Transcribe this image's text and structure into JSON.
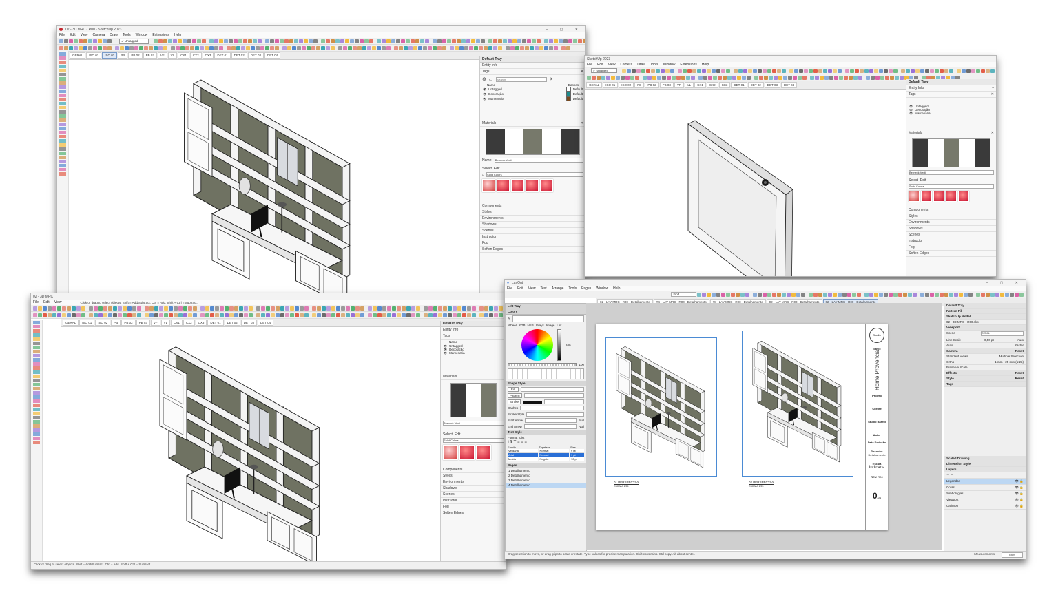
{
  "win1": {
    "title": "02 - 3D MRC - R00 - SketchUp 2023",
    "menu": [
      "File",
      "Edit",
      "View",
      "Camera",
      "Draw",
      "Tools",
      "Window",
      "Extensions",
      "Help"
    ],
    "tag_select": "Untagged",
    "tabs": [
      "GERAL",
      "ISO 01",
      "ISO 02",
      "PB",
      "PB 02",
      "PB 03",
      "VF",
      "VL",
      "CX1",
      "CX2",
      "CX3",
      "DET 01",
      "DET 02",
      "DET 03",
      "DET 04"
    ],
    "active_tab": 2,
    "tray": {
      "title": "Default Tray",
      "entity_info": "Entity Info",
      "tags": "Tags",
      "search_placeholder": "Search",
      "col_name": "Name",
      "col_dashes": "Dashes",
      "tag_rows": [
        {
          "name": "Untagged",
          "dash": "Default",
          "color": "#ffffff"
        },
        {
          "name": "Decoração",
          "dash": "Default",
          "color": "#1e8c8c"
        },
        {
          "name": "Marcenaria",
          "dash": "Default",
          "color": "#7a4a1e"
        }
      ],
      "materials": "Materials",
      "name_label": "Name:",
      "material_name": "Berneck Verti",
      "select": "Select",
      "edit": "Edit",
      "library": "Solid Colors",
      "sections": [
        "Components",
        "Styles",
        "Environments",
        "Shadows",
        "Scenes",
        "Instructor",
        "Fog",
        "Soften Edges"
      ]
    }
  },
  "win2": {
    "title": "SketchUp 2023",
    "tabs": [
      "GERAL",
      "ISO 01",
      "ISO 02",
      "PB",
      "PB 02",
      "PB 03",
      "VF",
      "VL",
      "CX1",
      "CX2",
      "CX3",
      "DET 01",
      "DET 02",
      "DET 03",
      "DET 04"
    ],
    "tag_select": "Untagged",
    "tray_title": "Default Tray",
    "entity_info": "Entity Info",
    "tags": "Tags",
    "tag_rows": [
      "Untagged",
      "Decoração",
      "Marcenaria"
    ],
    "materials": "Materials",
    "material_name": "Berneck Verti",
    "select": "Select",
    "edit": "Edit",
    "library": "Solid Colors",
    "sections": [
      "Components",
      "Styles",
      "Environments",
      "Shadows",
      "Scenes",
      "Instructor",
      "Fog",
      "Soften Edges"
    ]
  },
  "win3": {
    "title": "02 - 3D MRC",
    "menu": [
      "File",
      "Edit",
      "View"
    ],
    "hint": "Click or drag to select objects. Shift = Add/Subtract. Ctrl = Add. Shift + Ctrl = Subtract.",
    "tabs": [
      "GERAL",
      "ISO 01",
      "ISO 02",
      "PB",
      "PB 02",
      "PB 03",
      "VF",
      "VL",
      "CX1",
      "CX2",
      "CX3",
      "DET 01",
      "DET 02",
      "DET 03",
      "DET 04"
    ],
    "status": "Click or drag to select objects. Shift = Add/Subtract. Ctrl = Add. Shift + Ctrl = Subtract.",
    "tray_title": "Default Tray",
    "entity_info": "Entity Info",
    "tags": "Tags",
    "tag_rows": [
      "Untagged",
      "Decoração",
      "Marcenaria"
    ],
    "col_name": "Name",
    "materials": "Materials",
    "material_name": "Berneck Verti",
    "select": "Select",
    "edit": "Edit",
    "library": "Solid Colors",
    "sections": [
      "Components",
      "Styles",
      "Environments",
      "Shadows",
      "Scenes",
      "Instructor",
      "Fog",
      "Soften Edges"
    ]
  },
  "layout": {
    "title": "LayOut",
    "menu": [
      "File",
      "Edit",
      "View",
      "Text",
      "Arrange",
      "Tools",
      "Pages",
      "Window",
      "Help"
    ],
    "find": "Find...",
    "doc_tabs": [
      "02 - LAY MRC - R00 - Detalhamento",
      "#4 - LAY MRC - R00 - Detalhamento",
      "#8 - LAY MRC - R00 - Detalhamento",
      "02 - LAY MRC - R00 - Detalhamento",
      "02 - LAY MRC - R00 - Detalhamento"
    ],
    "left_tray": "Left Tray",
    "colors": "Colors",
    "color_tabs": [
      "Wheel",
      "RGB",
      "HSB",
      "Grays",
      "Image",
      "List"
    ],
    "color_opacity_a": "100",
    "color_opacity_b": "100",
    "shape_style": "Shape Style",
    "fill": "Fill",
    "pattern": "Pattern",
    "stroke": "Stroke",
    "dashes": "Dashes",
    "stroke_style": "Stroke Style",
    "start_arrow": "Start Arrow",
    "end_arrow": "End Arrow",
    "arrow_val": "Null",
    "text_style": "Text Style",
    "format": "Format",
    "list": "List",
    "family": "Family",
    "typeface": "Typeface",
    "size": "Size",
    "family_vals": [
      "Verdana",
      "Arial",
      "Mukta"
    ],
    "typeface_vals": [
      "Normal",
      "Normal",
      "Negrito"
    ],
    "size_vals": [
      "9 pt",
      "9 pt",
      "10 pt"
    ],
    "pages": "Pages",
    "page_list": [
      "1  Detalhamento",
      "2  Detalhamento",
      "3  Detalhamento",
      "4  Detalhamento"
    ],
    "right_tray": "Default Tray",
    "pattern_fill": "Pattern Fill",
    "sketchup_model": "SketchUp Model",
    "model_file": "02 - 3D MRC - R00.skp",
    "viewport": "Viewport",
    "scene": "Scene",
    "scene_val": "GERAL",
    "line_scale": "Line Scale",
    "line_scale_val": "0,50 pt",
    "auto": "Auto",
    "render": "Raster",
    "camera": "Camera",
    "reset": "Reset",
    "standard_views": "Standard Views",
    "standard_views_val": "Multiple Selection",
    "ortho": "Ortho",
    "ortho_val": "1 mm : 25 mm  (1:25)",
    "preserve_scale": "Preserve Scale",
    "effects": "Effects",
    "style": "Style",
    "tags_label": "Tags",
    "scaled_drawing": "Scaled Drawing",
    "dimension_style": "Dimension Style",
    "layers": "Layers",
    "layer_list": [
      "Legendas",
      "Cotas",
      "Simbologias",
      "Viewport",
      "Carimbo"
    ],
    "status": "Drag selection to move, or drag grips to scale or rotate. Type values for precise manipulation. Shift constrains. Ctrl copy. Alt about center.",
    "measurements": "Measurements",
    "zoom": "88%",
    "sheet": {
      "logo": "Studio Barelli",
      "projeto_label": "Projeto",
      "projeto": "Home Provencial",
      "cliente": "Cliente",
      "studio": "Studio Barelli",
      "autor": "Autor",
      "data": "Data Emissão",
      "desenho_label": "Desenho",
      "desenho": "Detalhamento",
      "escala_label": "Escala",
      "escala": "Indicada",
      "rev_label": "REV.",
      "rev": "R00",
      "page_no": "0",
      "page_total": "/04",
      "vp1_label": "01 PERSPECTIVA",
      "vp1_sub": "ESCALA 1/25",
      "vp2_label": "02 PERSPECTIVA",
      "vp2_sub": "ESCALA 1/25"
    }
  }
}
